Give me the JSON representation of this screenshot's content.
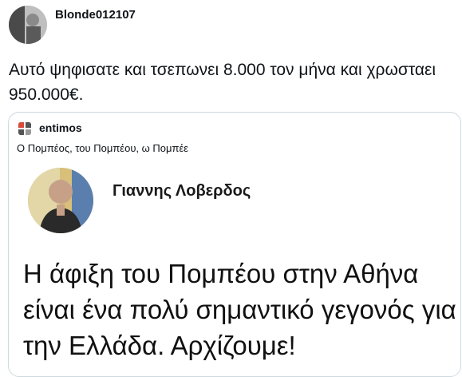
{
  "tweet": {
    "author": "Blonde012107",
    "text": "Αυτό ψηφισατε και τσεπωνει 8.000 τον μήνα και χρωσταει 950.000€."
  },
  "quoted": {
    "author": "entimos",
    "text": "Ο Πομπέος, του Πομπέου, ω Πομπέε",
    "card": {
      "name": "Γιαννης Λοβερδος",
      "statement": "Η άφιξη του Πομπέου στην Αθήνα είναι ένα πολύ σημαντικό γεγονός για την Ελλάδα. Αρχίζουμε!"
    }
  }
}
